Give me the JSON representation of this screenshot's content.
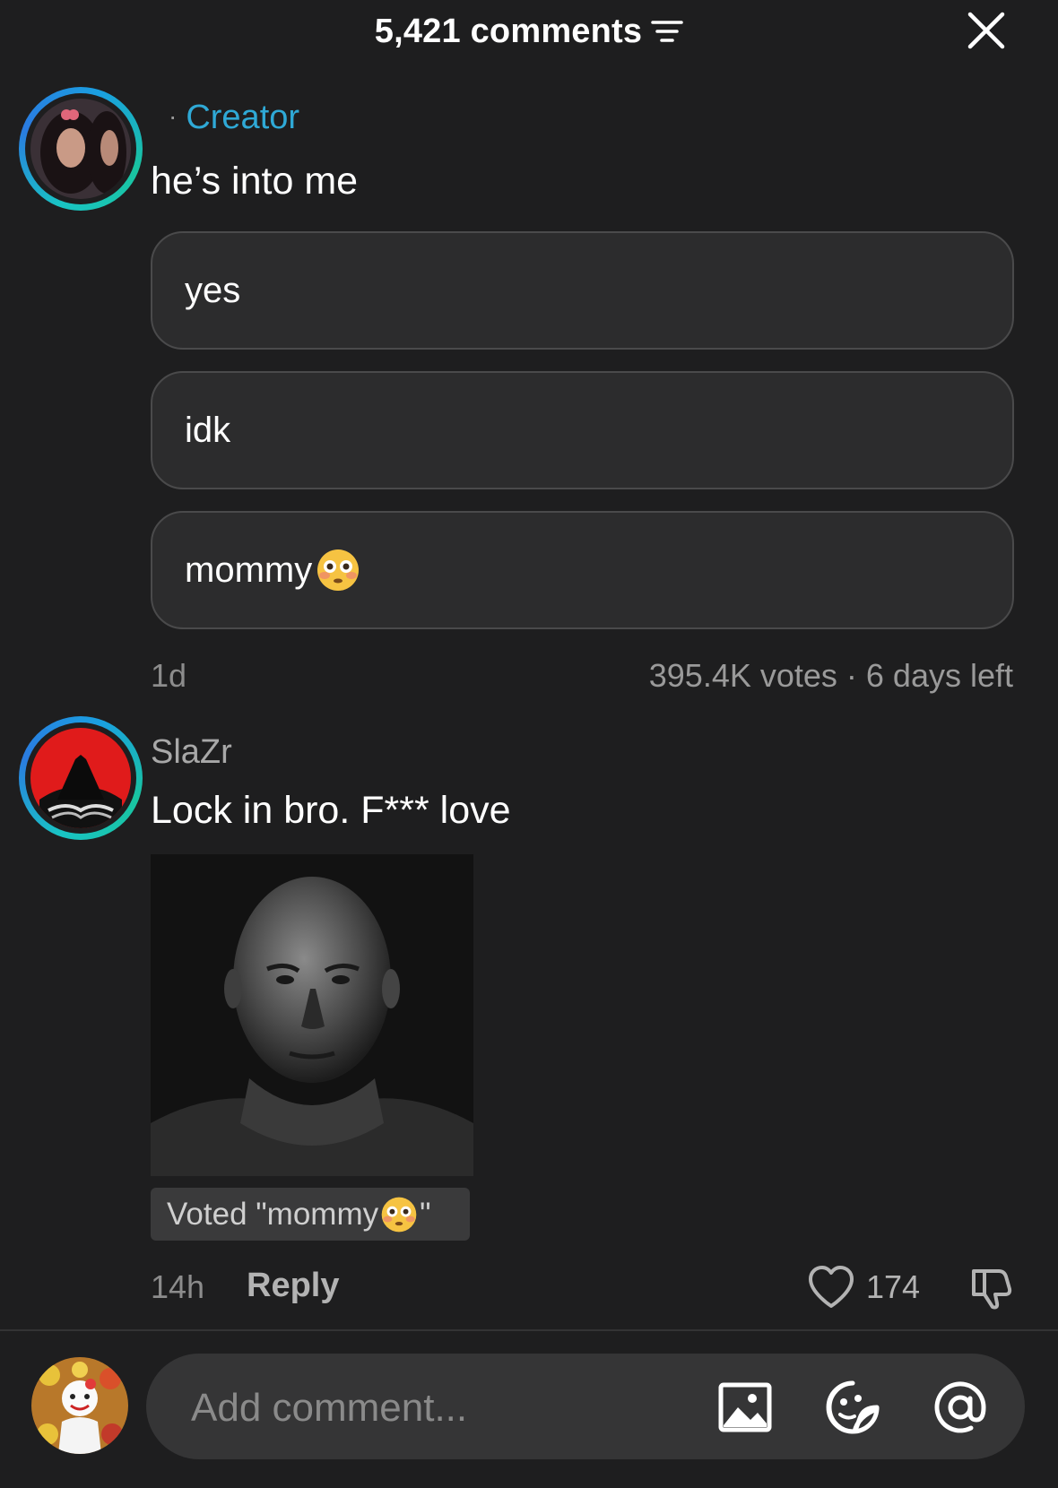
{
  "header": {
    "title": "5,421 comments"
  },
  "post": {
    "creator_label": "Creator",
    "text": "he’s into me",
    "poll_options": [
      {
        "label": "yes",
        "emoji": ""
      },
      {
        "label": "idk",
        "emoji": ""
      },
      {
        "label": "mommy",
        "emoji": "flushed-face"
      }
    ],
    "age": "1d",
    "votes_info": "395.4K votes · 6 days left"
  },
  "reply": {
    "username": "SlaZr",
    "text": "Lock in bro. F*** love",
    "voted_prefix": "Voted \"mommy",
    "voted_suffix": "\"",
    "age": "14h",
    "reply_label": "Reply",
    "like_count": "174"
  },
  "composer": {
    "placeholder": "Add comment..."
  },
  "colors": {
    "background": "#1e1e1f",
    "creator_accent": "#2fa9d6",
    "ring_gradient": "#19c4c4"
  }
}
